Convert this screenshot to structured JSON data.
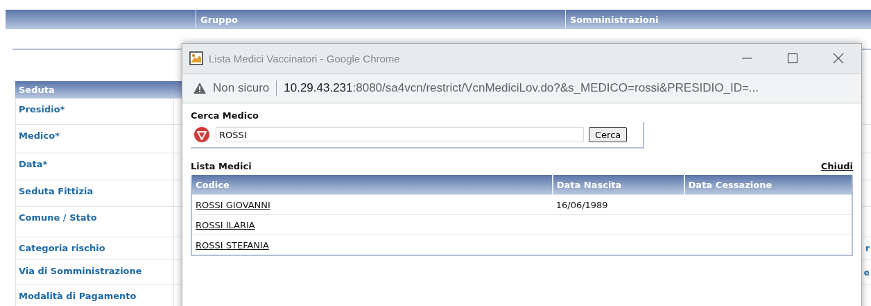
{
  "background": {
    "header_columns": [
      "Gruppo",
      "Somministrazioni"
    ],
    "section": {
      "title": "Seduta",
      "fields": [
        {
          "label": "Presidio*"
        },
        {
          "label": "Medico*"
        },
        {
          "label": "Data*"
        },
        {
          "label": "Seduta Fittizia"
        },
        {
          "label": "Comune / Stato"
        },
        {
          "label": "Categoria rischio",
          "value": "r"
        },
        {
          "label": "Via di Somministrazione",
          "value": "e"
        },
        {
          "label": "Modalità di Pagamento"
        }
      ]
    }
  },
  "popup": {
    "window_title": "Lista Medici Vaccinatori - Google Chrome",
    "address": {
      "security": "Non sicuro",
      "host": "10.29.43.231",
      "path": ":8080/sa4vcn/restrict/VcnMediciLov.do?&s_MEDICO=rossi&PRESIDIO_ID=..."
    },
    "search": {
      "title": "Cerca Medico",
      "value": "ROSSI",
      "button": "Cerca"
    },
    "list": {
      "title": "Lista Medici",
      "close_link": "Chiudi",
      "columns": [
        "Codice",
        "Data Nascita",
        "Data Cessazione"
      ],
      "rows": [
        {
          "codice": "ROSSI GIOVANNI",
          "data_nascita": "16/06/1989"
        },
        {
          "codice": "ROSSI ILARIA"
        },
        {
          "codice": "ROSSI STEFANIA"
        }
      ]
    }
  }
}
